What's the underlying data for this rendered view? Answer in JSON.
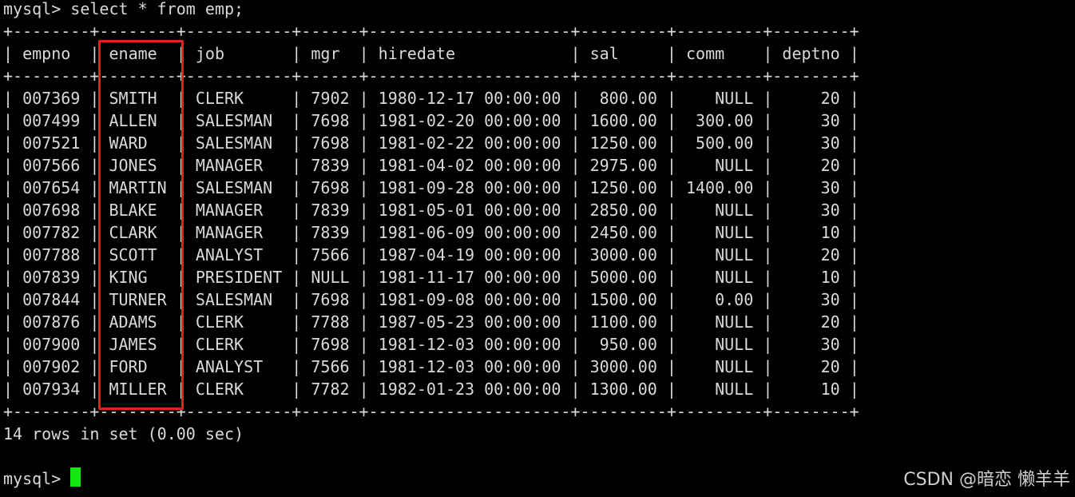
{
  "terminal": {
    "command_line": "mysql> select * from emp;",
    "prompt": "mysql> ",
    "result_summary": "14 rows in set (0.00 sec)",
    "cursor_color": "#14e814",
    "highlight_color": "#e81e1e",
    "background": "#000000",
    "text_color": "#d9d9d9"
  },
  "table": {
    "border_line": "+--------+--------+-----------+------+---------------------+---------+---------+--------+",
    "headers": [
      "empno",
      "ename",
      "job",
      "mgr",
      "hiredate",
      "sal",
      "comm",
      "deptno"
    ],
    "highlighted_column": "ename",
    "rows": [
      [
        "007369",
        "SMITH",
        "CLERK",
        "7902",
        "1980-12-17 00:00:00",
        "800.00",
        "NULL",
        "20"
      ],
      [
        "007499",
        "ALLEN",
        "SALESMAN",
        "7698",
        "1981-02-20 00:00:00",
        "1600.00",
        "300.00",
        "30"
      ],
      [
        "007521",
        "WARD",
        "SALESMAN",
        "7698",
        "1981-02-22 00:00:00",
        "1250.00",
        "500.00",
        "30"
      ],
      [
        "007566",
        "JONES",
        "MANAGER",
        "7839",
        "1981-04-02 00:00:00",
        "2975.00",
        "NULL",
        "20"
      ],
      [
        "007654",
        "MARTIN",
        "SALESMAN",
        "7698",
        "1981-09-28 00:00:00",
        "1250.00",
        "1400.00",
        "30"
      ],
      [
        "007698",
        "BLAKE",
        "MANAGER",
        "7839",
        "1981-05-01 00:00:00",
        "2850.00",
        "NULL",
        "30"
      ],
      [
        "007782",
        "CLARK",
        "MANAGER",
        "7839",
        "1981-06-09 00:00:00",
        "2450.00",
        "NULL",
        "10"
      ],
      [
        "007788",
        "SCOTT",
        "ANALYST",
        "7566",
        "1987-04-19 00:00:00",
        "3000.00",
        "NULL",
        "20"
      ],
      [
        "007839",
        "KING",
        "PRESIDENT",
        "NULL",
        "1981-11-17 00:00:00",
        "5000.00",
        "NULL",
        "10"
      ],
      [
        "007844",
        "TURNER",
        "SALESMAN",
        "7698",
        "1981-09-08 00:00:00",
        "1500.00",
        "0.00",
        "30"
      ],
      [
        "007876",
        "ADAMS",
        "CLERK",
        "7788",
        "1987-05-23 00:00:00",
        "1100.00",
        "NULL",
        "20"
      ],
      [
        "007900",
        "JAMES",
        "CLERK",
        "7698",
        "1981-12-03 00:00:00",
        "950.00",
        "NULL",
        "30"
      ],
      [
        "007902",
        "FORD",
        "ANALYST",
        "7566",
        "1981-12-03 00:00:00",
        "3000.00",
        "NULL",
        "20"
      ],
      [
        "007934",
        "MILLER",
        "CLERK",
        "7782",
        "1982-01-23 00:00:00",
        "1300.00",
        "NULL",
        "10"
      ]
    ]
  },
  "watermark": "CSDN @暗恋 懒羊羊"
}
